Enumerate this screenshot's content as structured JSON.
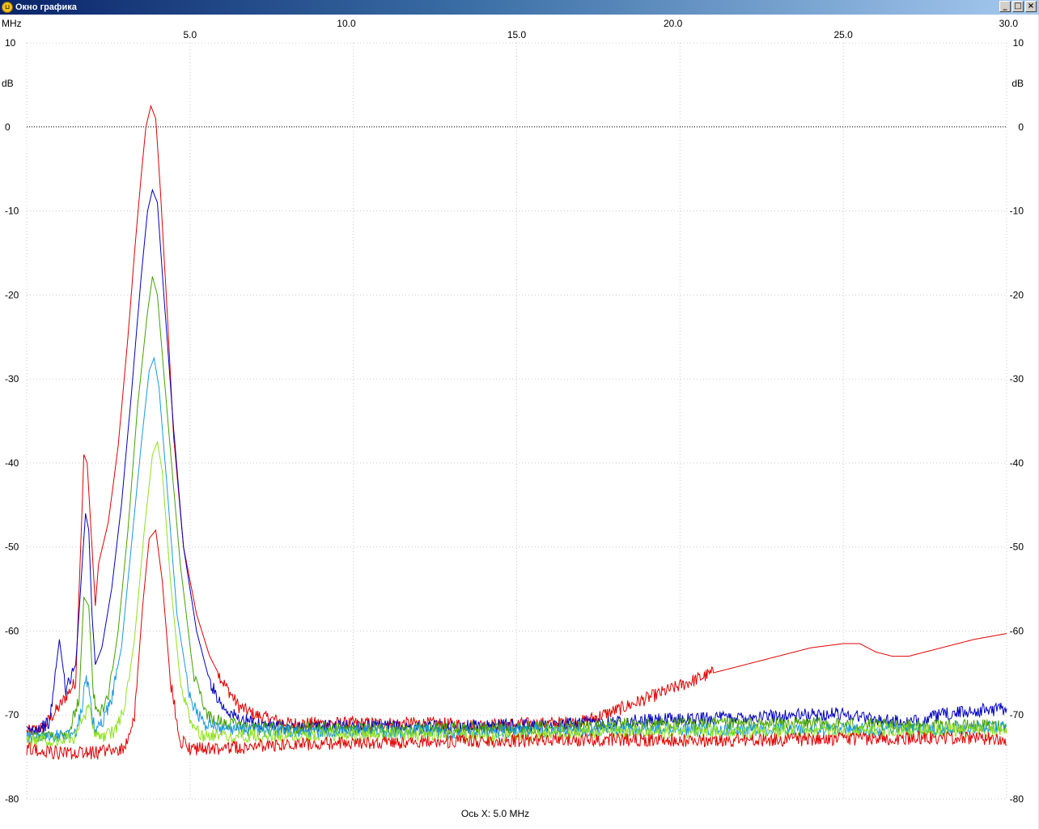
{
  "window": {
    "title": "Окно графика",
    "minimize_glyph": "_",
    "maximize_glyph": "□",
    "close_glyph": "×"
  },
  "chart_data": {
    "type": "line",
    "x_unit": "MHz",
    "y_unit": "dB",
    "xlim": [
      0,
      30
    ],
    "ylim": [
      -80,
      10
    ],
    "x_ticks_upper": [
      "10.0",
      "20.0",
      "30.0"
    ],
    "x_ticks_lower": [
      "5.0",
      "15.0",
      "25.0"
    ],
    "y_ticks": [
      "10",
      "0",
      "-10",
      "-20",
      "-30",
      "-40",
      "-50",
      "-60",
      "-70",
      "-80"
    ],
    "reference_line": 0,
    "grid": true,
    "footer": "Ось X: 5.0 MHz",
    "colors": {
      "red": "#e00000",
      "blue": "#0000c0",
      "green": "#44a000",
      "cyan": "#1898e0",
      "lime": "#90e020",
      "grid": "#c8c8c8"
    },
    "series": [
      {
        "color": "red",
        "x": [
          0,
          0.5,
          1.0,
          1.5,
          1.7,
          1.75,
          1.85,
          2.0,
          2.1,
          2.2,
          2.5,
          2.8,
          3.1,
          3.3,
          3.5,
          3.65,
          3.8,
          3.95,
          4.1,
          4.3,
          4.5,
          4.8,
          5.2,
          5.6,
          6.0,
          6.5,
          7.0,
          7.5,
          8.0,
          10,
          12,
          14,
          16,
          17,
          18,
          19,
          20,
          21,
          22,
          23,
          24,
          25,
          25.5,
          26,
          26.5,
          27,
          28,
          29,
          30
        ],
        "y": [
          -72,
          -71.5,
          -69,
          -66,
          -45,
          -39,
          -40,
          -50,
          -57,
          -52,
          -47,
          -38,
          -25,
          -15,
          -6,
          0,
          2.5,
          1,
          -8,
          -22,
          -37,
          -50,
          -58,
          -63,
          -66,
          -69,
          -70,
          -70.5,
          -71,
          -71,
          -71,
          -71.2,
          -71,
          -70.8,
          -69.5,
          -68,
          -66.5,
          -65,
          -64,
          -63,
          -62,
          -61.5,
          -61.5,
          -62.5,
          -63,
          -63,
          -62,
          -61,
          -60.3
        ]
      },
      {
        "color": "blue",
        "x": [
          0,
          0.7,
          1.0,
          1.2,
          1.5,
          1.7,
          1.8,
          1.9,
          2.0,
          2.1,
          2.3,
          2.6,
          2.9,
          3.2,
          3.5,
          3.7,
          3.85,
          4.0,
          4.2,
          4.5,
          4.8,
          5.2,
          5.6,
          6.0,
          6.5,
          7.0,
          8,
          10,
          12,
          14,
          16,
          18,
          20,
          22,
          24,
          25,
          26,
          27,
          28,
          29,
          30
        ],
        "y": [
          -72,
          -71,
          -61,
          -67,
          -64,
          -52,
          -46,
          -48,
          -58,
          -64,
          -62,
          -55,
          -45,
          -32,
          -18,
          -10,
          -7.5,
          -9,
          -20,
          -36,
          -50,
          -60,
          -66,
          -69,
          -70.5,
          -71,
          -71.5,
          -71.3,
          -71.5,
          -71.3,
          -71.2,
          -70.8,
          -70.5,
          -70.2,
          -70,
          -69.8,
          -70.5,
          -71,
          -70,
          -69.5,
          -69.2
        ]
      },
      {
        "color": "green",
        "x": [
          0,
          0.8,
          1.3,
          1.6,
          1.75,
          1.9,
          2.05,
          2.2,
          2.5,
          2.8,
          3.1,
          3.4,
          3.7,
          3.85,
          4.0,
          4.3,
          4.7,
          5.1,
          5.5,
          6.0,
          7,
          8,
          10,
          12,
          14,
          16,
          18,
          20,
          22,
          24,
          26,
          28,
          30
        ],
        "y": [
          -72.5,
          -72.5,
          -72,
          -68,
          -56,
          -57,
          -68,
          -70,
          -68,
          -60,
          -48,
          -33,
          -22,
          -17.8,
          -20,
          -34,
          -52,
          -65,
          -70,
          -71,
          -71.5,
          -71.5,
          -71.7,
          -71.5,
          -71.6,
          -71.4,
          -71.2,
          -71,
          -71.1,
          -71,
          -71.2,
          -71.3,
          -71.3
        ]
      },
      {
        "color": "cyan",
        "x": [
          0,
          1.0,
          1.5,
          1.7,
          1.8,
          1.9,
          2.0,
          2.1,
          2.3,
          2.6,
          2.9,
          3.2,
          3.5,
          3.75,
          3.9,
          4.05,
          4.3,
          4.6,
          5.0,
          5.4,
          6,
          7,
          8,
          10,
          12,
          14,
          16,
          18,
          20,
          22,
          24,
          26,
          28,
          30
        ],
        "y": [
          -72.5,
          -72.5,
          -72,
          -69,
          -66,
          -66,
          -70,
          -72,
          -71,
          -68,
          -62,
          -50,
          -38,
          -29,
          -27.5,
          -31,
          -43,
          -58,
          -68,
          -71,
          -71.5,
          -71.8,
          -72,
          -72,
          -72,
          -72.1,
          -71.9,
          -71.8,
          -71.7,
          -71.8,
          -71.8,
          -71.7,
          -71.6,
          -71.5
        ]
      },
      {
        "color": "lime",
        "x": [
          0,
          1.0,
          1.5,
          1.8,
          1.9,
          2.0,
          2.1,
          2.3,
          2.7,
          3.0,
          3.3,
          3.6,
          3.85,
          4.0,
          4.15,
          4.4,
          4.7,
          5.0,
          5.4,
          6,
          7,
          8,
          10,
          12,
          14,
          16,
          18,
          20,
          22,
          24,
          26,
          28,
          30
        ],
        "y": [
          -73,
          -73,
          -72.5,
          -70,
          -69,
          -71,
          -72.5,
          -72.5,
          -72,
          -69,
          -61,
          -48,
          -39,
          -37.5,
          -41,
          -54,
          -66,
          -71,
          -72.5,
          -72.5,
          -72.5,
          -72.5,
          -72.3,
          -72.3,
          -72.4,
          -72.2,
          -72,
          -72,
          -72,
          -71.9,
          -71.8,
          -71.8,
          -71.8
        ]
      },
      {
        "color": "red",
        "x": [
          0,
          1.0,
          2.0,
          3.0,
          3.3,
          3.55,
          3.75,
          3.95,
          4.15,
          4.4,
          4.7,
          5.0,
          6,
          8,
          10,
          12,
          14,
          16,
          18,
          20,
          22,
          24,
          26,
          28,
          30
        ],
        "y": [
          -74,
          -74.5,
          -74.5,
          -74,
          -70,
          -57,
          -49,
          -48,
          -54,
          -66,
          -73,
          -74,
          -74,
          -73.5,
          -73.3,
          -73.2,
          -73.1,
          -73,
          -72.9,
          -73,
          -73,
          -72.9,
          -72.8,
          -72.7,
          -72.8
        ]
      }
    ]
  }
}
